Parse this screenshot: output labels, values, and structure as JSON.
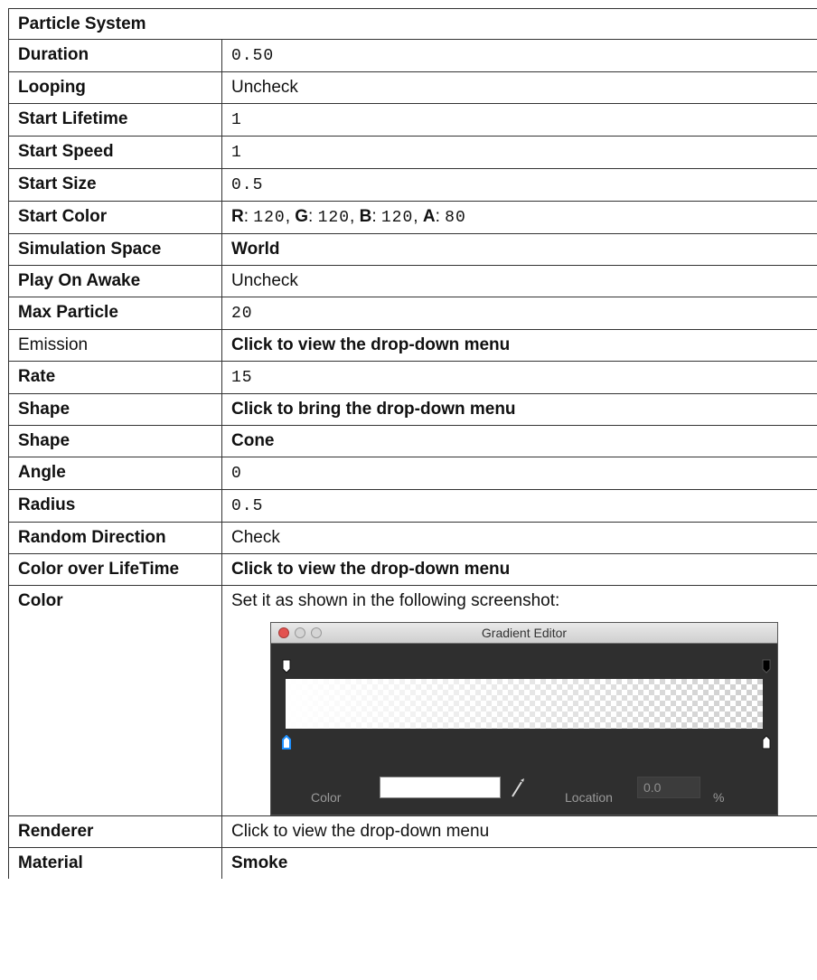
{
  "header": "Particle System",
  "rows": [
    {
      "label": "Duration",
      "value": "0.50"
    },
    {
      "label": "Looping",
      "value": "Uncheck"
    },
    {
      "label": "Start Lifetime",
      "value": "1"
    },
    {
      "label": "Start Speed",
      "value": "1"
    },
    {
      "label": "Start Size",
      "value": "0.5"
    },
    {
      "label": "Start Color",
      "r_label": "R",
      "r": "120",
      "g_label": "G",
      "g": "120",
      "b_label": "B",
      "b": "120",
      "a_label": "A",
      "a": "80"
    },
    {
      "label": "Simulation Space",
      "value": "World"
    },
    {
      "label": "Play On Awake",
      "value": "Uncheck"
    },
    {
      "label": "Max Particle",
      "value": "20"
    },
    {
      "label": "Emission",
      "value": "Click to view the drop-down menu"
    },
    {
      "label": "Rate",
      "value": "15"
    },
    {
      "label": "Shape",
      "value": "Click to bring the drop-down menu"
    },
    {
      "label": "Shape",
      "value": "Cone"
    },
    {
      "label": "Angle",
      "value": "0"
    },
    {
      "label": "Radius",
      "value": "0.5"
    },
    {
      "label": "Random Direction",
      "value": "Check"
    },
    {
      "label": "Color over LifeTime",
      "value": "Click to view the drop-down menu"
    },
    {
      "label": "Color",
      "value": "Set it as shown in the following screenshot:"
    },
    {
      "label": "Renderer",
      "value": "Click to view the drop-down menu"
    },
    {
      "label": "Material",
      "value": "Smoke"
    }
  ],
  "gradient_editor": {
    "title": "Gradient Editor",
    "color_label": "Color",
    "location_label": "Location",
    "location_value": "0.0",
    "percent": "%"
  },
  "colors": {
    "border": "#333333",
    "editor_bg": "#2f2f2f",
    "red_light": "#e3524f",
    "marker_selected": "#1e90ff"
  }
}
